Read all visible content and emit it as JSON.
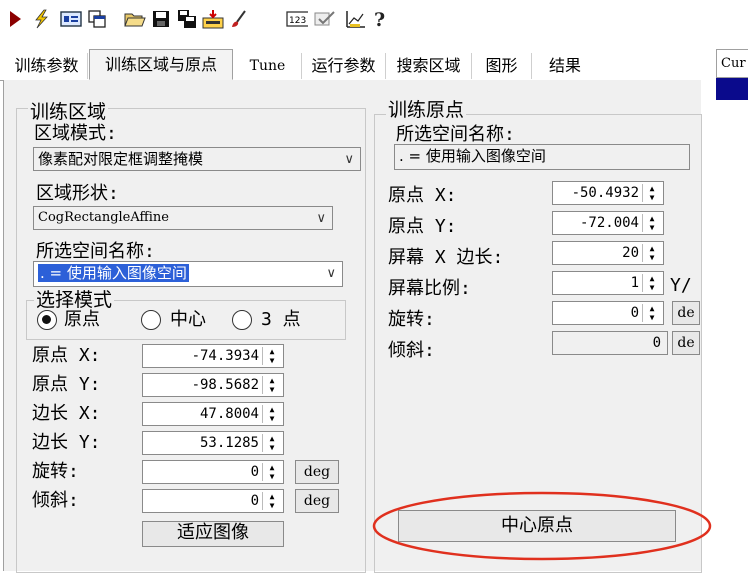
{
  "toolbar": {
    "icons": [
      "play-icon",
      "run-flash-icon",
      "image-view-icon",
      "copy-window-icon",
      "open-folder-icon",
      "save-icon",
      "save-all-icon",
      "import-icon",
      "brush-icon",
      "numeric-display-icon",
      "checkmark-icon",
      "chart-tool-icon",
      "help-icon"
    ]
  },
  "tabs": [
    {
      "label": "训练参数"
    },
    {
      "label": "训练区域与原点"
    },
    {
      "label": "Tune"
    },
    {
      "label": "运行参数"
    },
    {
      "label": "搜索区域"
    },
    {
      "label": "图形"
    },
    {
      "label": "结果"
    }
  ],
  "right_panel": {
    "label": "Cur"
  },
  "train_region": {
    "title": "训练区域",
    "region_mode_label": "区域模式:",
    "region_mode_value": "像素配对限定框调整掩模",
    "region_shape_label": "区域形状:",
    "region_shape_value": "CogRectangleAffine",
    "space_name_label": "所选空间名称:",
    "space_name_value": ". = 使用输入图像空间",
    "select_mode": {
      "title": "选择模式",
      "options": [
        "原点",
        "中心",
        "3 点"
      ],
      "selected": "原点"
    },
    "origin_x_label": "原点 X:",
    "origin_x": "-74.3934",
    "origin_y_label": "原点 Y:",
    "origin_y": "-98.5682",
    "side_x_label": "边长 X:",
    "side_x": "47.8004",
    "side_y_label": "边长 Y:",
    "side_y": "53.1285",
    "rotation_label": "旋转:",
    "rotation": "0",
    "skew_label": "倾斜:",
    "skew": "0",
    "deg_label": "deg",
    "fit_image_button": "适应图像"
  },
  "train_origin": {
    "title": "训练原点",
    "space_name_label": "所选空间名称:",
    "space_name_value": ". = 使用输入图像空间",
    "origin_x_label": "原点 X:",
    "origin_x": "-50.4932",
    "origin_y_label": "原点 Y:",
    "origin_y": "-72.004",
    "screen_x_side_label": "屏幕 X 边长:",
    "screen_x_side": "20",
    "screen_ratio_label": "屏幕比例:",
    "screen_ratio": "1",
    "screen_ratio_unit": "Y/",
    "rotation_label": "旋转:",
    "rotation": "0",
    "skew_label": "倾斜:",
    "skew": "0",
    "deg_label": "de",
    "center_origin_button": "中心原点"
  },
  "colors": {
    "selection": "#2c60d8",
    "annotation": "#e0301e"
  }
}
